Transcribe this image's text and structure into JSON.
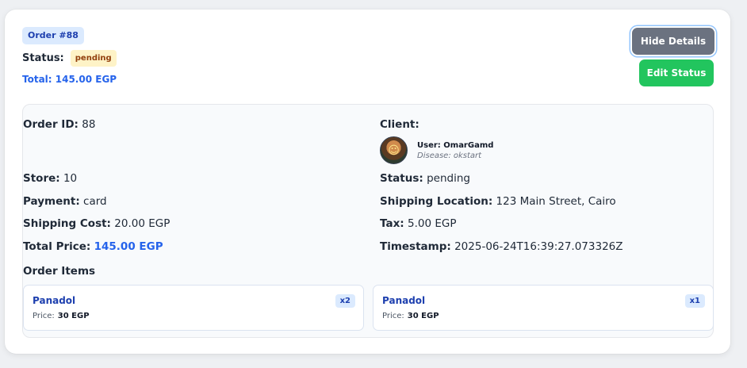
{
  "order": {
    "badge": "Order #88",
    "status_label": "Status:",
    "status_value": "pending",
    "total_text": "Total: 145.00 EGP"
  },
  "buttons": {
    "hide_details": "Hide Details",
    "edit_status": "Edit Status"
  },
  "details": {
    "order_id": {
      "label": "Order ID:",
      "value": "88"
    },
    "client": {
      "label": "Client:",
      "user_text": "User: OmarGamd",
      "disease_text": "Disease: okstart"
    },
    "store": {
      "label": "Store:",
      "value": "10"
    },
    "status": {
      "label": "Status:",
      "value": "pending"
    },
    "payment": {
      "label": "Payment:",
      "value": "card"
    },
    "shipping_location": {
      "label": "Shipping Location:",
      "value": "123 Main Street, Cairo"
    },
    "shipping_cost": {
      "label": "Shipping Cost:",
      "value": "20.00 EGP"
    },
    "tax": {
      "label": "Tax:",
      "value": "5.00 EGP"
    },
    "total_price": {
      "label": "Total Price:",
      "value": "145.00 EGP"
    },
    "timestamp": {
      "label": "Timestamp:",
      "value": "2025-06-24T16:39:27.073326Z"
    }
  },
  "items_title": "Order Items",
  "items": [
    {
      "name": "Panadol",
      "qty": "x2",
      "price_label": "Price:",
      "price": "30 EGP"
    },
    {
      "name": "Panadol",
      "qty": "x1",
      "price_label": "Price:",
      "price": "30 EGP"
    }
  ],
  "colors": {
    "accent_blue": "#2563eb",
    "pending_bg": "#fef3c7",
    "edit_green": "#22c55e",
    "hide_gray": "#6b7280"
  }
}
